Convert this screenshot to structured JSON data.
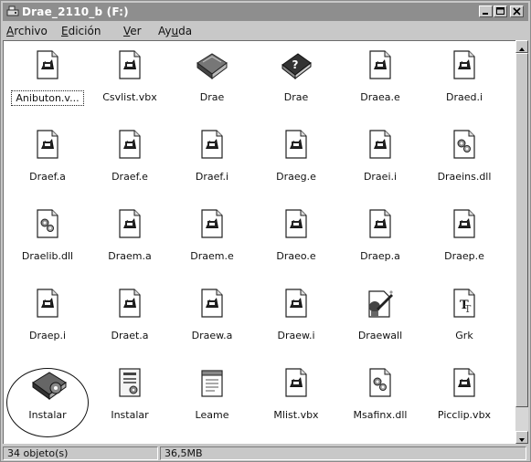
{
  "window": {
    "title": "Drae_2110_b (F:)",
    "buttons": [
      {
        "name": "minimize-button",
        "icon": "minimize-icon"
      },
      {
        "name": "maximize-button",
        "icon": "maximize-icon"
      },
      {
        "name": "close-button",
        "icon": "close-icon"
      }
    ]
  },
  "menu": {
    "archivo": {
      "u": "A",
      "rest": "rchivo"
    },
    "edicion": {
      "u": "E",
      "rest": "dición"
    },
    "ver": {
      "u": "V",
      "rest": "er"
    },
    "ayuda": {
      "pre": "Ay",
      "u": "u",
      "rest": "da"
    }
  },
  "files": [
    {
      "label": "Anibuton.v...",
      "icon": "script-icon",
      "selected": true
    },
    {
      "label": "Csvlist.vbx",
      "icon": "script-icon"
    },
    {
      "label": "Drae",
      "icon": "book-icon"
    },
    {
      "label": "Drae",
      "icon": "help-book-icon"
    },
    {
      "label": "Draea.e",
      "icon": "script-icon"
    },
    {
      "label": "Draed.i",
      "icon": "script-icon"
    },
    {
      "label": "Draef.a",
      "icon": "script-icon"
    },
    {
      "label": "Draef.e",
      "icon": "script-icon"
    },
    {
      "label": "Draef.i",
      "icon": "script-icon"
    },
    {
      "label": "Draeg.e",
      "icon": "script-icon"
    },
    {
      "label": "Draei.i",
      "icon": "script-icon"
    },
    {
      "label": "Draeins.dll",
      "icon": "dll-icon"
    },
    {
      "label": "Draelib.dll",
      "icon": "dll-icon"
    },
    {
      "label": "Draem.a",
      "icon": "script-icon"
    },
    {
      "label": "Draem.e",
      "icon": "script-icon"
    },
    {
      "label": "Draeo.e",
      "icon": "script-icon"
    },
    {
      "label": "Draep.a",
      "icon": "script-icon"
    },
    {
      "label": "Draep.e",
      "icon": "script-icon"
    },
    {
      "label": "Draep.i",
      "icon": "script-icon"
    },
    {
      "label": "Draet.a",
      "icon": "script-icon"
    },
    {
      "label": "Draew.a",
      "icon": "script-icon"
    },
    {
      "label": "Draew.i",
      "icon": "script-icon"
    },
    {
      "label": "Draewall",
      "icon": "wizard-icon"
    },
    {
      "label": "Grk",
      "icon": "font-icon"
    },
    {
      "label": "Instalar",
      "icon": "install-book-icon"
    },
    {
      "label": "Instalar",
      "icon": "setup-icon"
    },
    {
      "label": "Leame",
      "icon": "notepad-icon"
    },
    {
      "label": "Mlist.vbx",
      "icon": "script-icon"
    },
    {
      "label": "Msafinx.dll",
      "icon": "dll-icon"
    },
    {
      "label": "Picclip.vbx",
      "icon": "script-icon"
    }
  ],
  "status": {
    "count": "34 objeto(s)",
    "size": "36,5MB"
  }
}
